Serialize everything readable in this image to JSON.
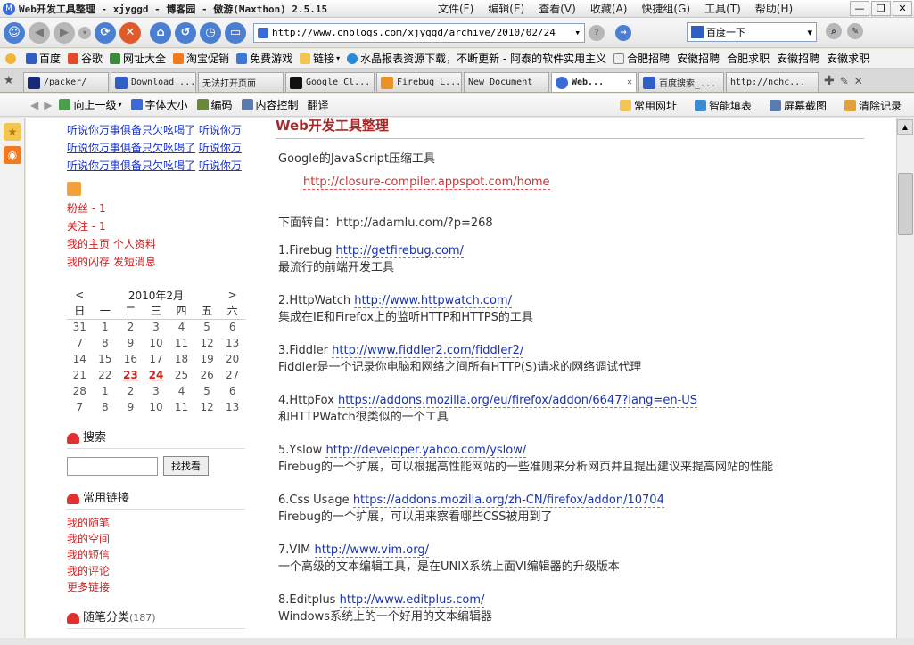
{
  "window": {
    "title": "Web开发工具整理 - xjyggd - 博客园 - 傲游(Maxthon) 2.5.15",
    "menus": [
      "文件(F)",
      "编辑(E)",
      "查看(V)",
      "收藏(A)",
      "快捷组(G)",
      "工具(T)",
      "帮助(H)"
    ]
  },
  "navbar": {
    "address": "http://www.cnblogs.com/xjyggd/archive/2010/02/24",
    "search_placeholder": "百度一下"
  },
  "favorites": [
    "百度",
    "谷歌",
    "网址大全",
    "淘宝促销",
    "免费游戏",
    "链接",
    "水晶报表资源下载，不断更新 - 阿泰的软件实用主义",
    "合肥招聘",
    "安徽招聘",
    "合肥求职",
    "安徽招聘",
    "安徽求职"
  ],
  "tabs": [
    {
      "label": "/packer/",
      "active": false
    },
    {
      "label": "Download ...",
      "active": false
    },
    {
      "label": "无法打开页面",
      "active": false
    },
    {
      "label": "Google Cl...",
      "active": false
    },
    {
      "label": "Firebug L...",
      "active": false
    },
    {
      "label": "New Document",
      "active": false
    },
    {
      "label": "Web...",
      "active": true
    },
    {
      "label": "百度搜索_...",
      "active": false
    },
    {
      "label": "http://nchc...",
      "active": false
    }
  ],
  "pagebar": {
    "items": [
      "向上一级",
      "字体大小",
      "编码",
      "内容控制",
      "翻译"
    ],
    "right": [
      "常用网址",
      "智能填表",
      "屏幕截图",
      "清除记录"
    ]
  },
  "sidebar": {
    "news_links": [
      "听说你万事俱备只欠吆喝了",
      "听说你万事俱备只欠吆喝了",
      "听说你万事俱备只欠吆喝了"
    ],
    "news_short": [
      "听说你万",
      "听说你万",
      "听说你万"
    ],
    "fans": "粉丝 - 1",
    "follow": "关注 - 1",
    "my_home": "我的主页",
    "profile": "个人资料",
    "my_flash": "我的闪存",
    "send_msg": "发短消息",
    "calendar": {
      "prev": "<",
      "next": ">",
      "month": "2010年2月",
      "weekdays": [
        "日",
        "一",
        "二",
        "三",
        "四",
        "五",
        "六"
      ],
      "weeks": [
        [
          "31",
          "1",
          "2",
          "3",
          "4",
          "5",
          "6"
        ],
        [
          "7",
          "8",
          "9",
          "10",
          "11",
          "12",
          "13"
        ],
        [
          "14",
          "15",
          "16",
          "17",
          "18",
          "19",
          "20"
        ],
        [
          "21",
          "22",
          "23",
          "24",
          "25",
          "26",
          "27"
        ],
        [
          "28",
          "1",
          "2",
          "3",
          "4",
          "5",
          "6"
        ],
        [
          "7",
          "8",
          "9",
          "10",
          "11",
          "12",
          "13"
        ]
      ]
    },
    "search_title": "搜索",
    "search_button": "找找看",
    "links_title": "常用链接",
    "links": [
      "我的随笔",
      "我的空间",
      "我的短信",
      "我的评论",
      "更多链接"
    ],
    "category_title": "随笔分类",
    "category_count": "(187)"
  },
  "article": {
    "title": "Web开发工具整理",
    "intro_label": "Google的JavaScript压缩工具",
    "intro_url": "http://closure-compiler.appspot.com/home",
    "source": "下面转自：http://adamlu.com/?p=268",
    "items": [
      {
        "label": "1.Firebug",
        "url": "http://getfirebug.com/",
        "desc": "最流行的前端开发工具"
      },
      {
        "label": "2.HttpWatch",
        "url": "http://www.httpwatch.com/",
        "desc": "集成在IE和Firefox上的监听HTTP和HTTPS的工具"
      },
      {
        "label": "3.Fiddler",
        "url": "http://www.fiddler2.com/fiddler2/",
        "desc": "Fiddler是一个记录你电脑和网络之间所有HTTP(S)请求的网络调试代理"
      },
      {
        "label": "4.HttpFox",
        "url": "https://addons.mozilla.org/eu/firefox/addon/6647?lang=en-US",
        "desc": "和HTTPWatch很类似的一个工具"
      },
      {
        "label": "5.Yslow",
        "url": "http://developer.yahoo.com/yslow/",
        "desc": "Firebug的一个扩展，可以根据高性能网站的一些准则来分析网页并且提出建议来提高网站的性能"
      },
      {
        "label": "6.Css Usage",
        "url": "https://addons.mozilla.org/zh-CN/firefox/addon/10704",
        "desc": "Firebug的一个扩展，可以用来察看哪些CSS被用到了"
      },
      {
        "label": "7.VIM",
        "url": "http://www.vim.org/",
        "desc": "一个高级的文本编辑工具，是在UNIX系统上面VI编辑器的升级版本"
      },
      {
        "label": "8.Editplus",
        "url": "http://www.editplus.com/",
        "desc": "Windows系统上的一个好用的文本编辑器"
      }
    ]
  }
}
